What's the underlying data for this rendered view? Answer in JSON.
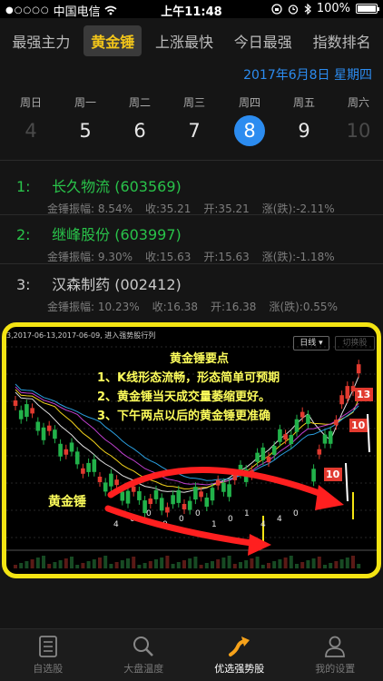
{
  "status": {
    "signal": "●○○○○",
    "carrier": "中国电信",
    "time": "上午11:48",
    "battery": "100%"
  },
  "tabs": [
    {
      "label": "最强主力",
      "active": false
    },
    {
      "label": "黄金锤",
      "active": true
    },
    {
      "label": "上涨最快",
      "active": false
    },
    {
      "label": "今日最强",
      "active": false
    },
    {
      "label": "指数排名",
      "active": false
    }
  ],
  "date": "2017年6月8日 星期四",
  "week": [
    {
      "weekday": "周日",
      "day": "4",
      "state": "dim"
    },
    {
      "weekday": "周一",
      "day": "5",
      "state": "normal"
    },
    {
      "weekday": "周二",
      "day": "6",
      "state": "normal"
    },
    {
      "weekday": "周三",
      "day": "7",
      "state": "normal"
    },
    {
      "weekday": "周四",
      "day": "8",
      "state": "selected"
    },
    {
      "weekday": "周五",
      "day": "9",
      "state": "normal"
    },
    {
      "weekday": "周六",
      "day": "10",
      "state": "dim"
    }
  ],
  "stocks": [
    {
      "index": "1:",
      "name": "长久物流",
      "code": "(603569)",
      "amplitude": "金锤振幅: 8.54%",
      "close": "收:35.21",
      "open": "开:35.21",
      "change": "涨(跌):-2.11%"
    },
    {
      "index": "2:",
      "name": "继峰股份",
      "code": "(603997)",
      "amplitude": "金锤振幅: 9.30%",
      "close": "收:15.63",
      "open": "开:15.63",
      "change": "涨(跌):-1.18%"
    },
    {
      "index": "3:",
      "name": "汉森制药",
      "code": "(002412)",
      "amplitude": "金锤振幅: 10.23%",
      "close": "收:16.38",
      "open": "开:16.38",
      "change": "涨(跌):0.55%"
    }
  ],
  "chart": {
    "caption": "3,2017-06-13,2017-06-09, 进入强势股行列",
    "period_button": "日线 ▾",
    "second_button": "切换股",
    "tips_title": "黄金锤要点",
    "tips": [
      "1、K线形态流畅，形态简单可预期",
      "2、黄金锤当天成交量萎缩更好。",
      "3、下午两点以后的黄金锤更准确"
    ],
    "hammer_label": "黄金锤",
    "counter_labels": [
      "4",
      "0",
      "0",
      "0",
      "0",
      "0",
      "1",
      "0",
      "1",
      "4",
      "4",
      "0"
    ],
    "badges": [
      "13",
      "10",
      "10"
    ],
    "colors": {
      "accent": "#f4e413",
      "up": "#e23a2f",
      "down": "#22b24a",
      "arrow": "#ff1f1f"
    }
  },
  "nav": [
    {
      "label": "自选股",
      "icon": "list-icon",
      "active": false
    },
    {
      "label": "大盘温度",
      "icon": "search-icon",
      "active": false
    },
    {
      "label": "优选强势股",
      "icon": "trend-arrow-icon",
      "active": true
    },
    {
      "label": "我的设置",
      "icon": "person-icon",
      "active": false
    }
  ]
}
